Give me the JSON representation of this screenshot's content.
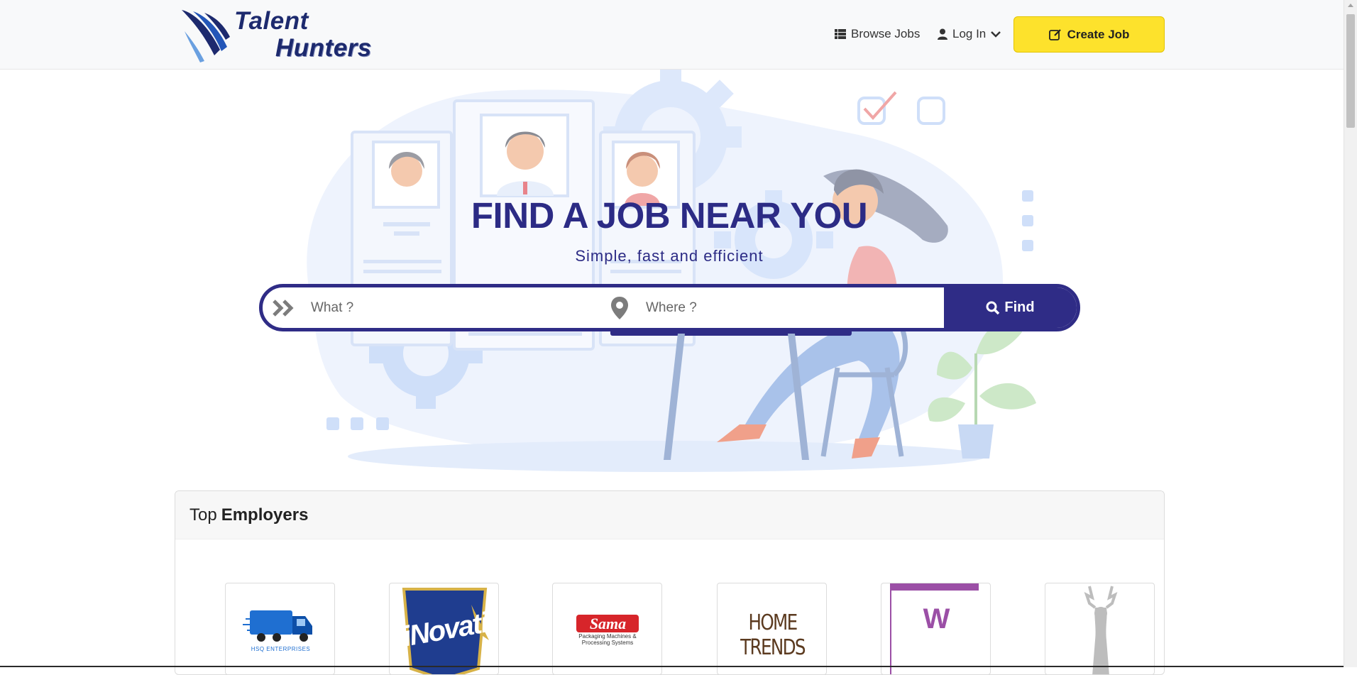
{
  "brand": {
    "name_line1": "Talent",
    "name_line2": "Hunters"
  },
  "nav": {
    "browse_jobs": "Browse Jobs",
    "log_in": "Log In",
    "create_job": "Create Job"
  },
  "hero": {
    "title": "FIND A JOB NEAR YOU",
    "subtitle": "Simple, fast and efficient"
  },
  "search": {
    "what_placeholder": "What ?",
    "what_value": "",
    "where_placeholder": "Where ?",
    "where_value": "",
    "find_label": "Find"
  },
  "employers": {
    "heading_prefix": "Top",
    "heading_bold": "Employers",
    "items": [
      {
        "name": "HSQ ENTERPRISES"
      },
      {
        "name": "iNovative"
      },
      {
        "name": "Sama",
        "tagline": "Packaging Machines & Processing Systems"
      },
      {
        "name": "HOME TRENDS"
      },
      {
        "name": "W"
      },
      {
        "name": "deer-logo"
      }
    ]
  },
  "colors": {
    "primary": "#2f2c86",
    "accent": "#fde22c",
    "illustration": "#dde8fb"
  }
}
